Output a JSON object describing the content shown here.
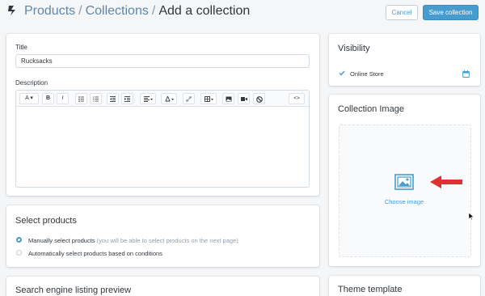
{
  "header": {
    "breadcrumb": {
      "products": "Products",
      "separator": "/",
      "collections": "Collections",
      "current": "Add a collection"
    },
    "cancel_label": "Cancel",
    "save_label": "Save collection"
  },
  "details": {
    "title_label": "Title",
    "title_value": "Rucksacks",
    "description_label": "Description",
    "toolbar": {
      "font_label": "A",
      "bold_label": "B",
      "italic_label": "I",
      "source_label": "<>"
    }
  },
  "select_products": {
    "heading": "Select products",
    "options": [
      {
        "label": "Manually select products",
        "hint": "(you will be able to select products on the next page)",
        "checked": true
      },
      {
        "label": "Automatically select products based on conditions",
        "hint": "",
        "checked": false
      }
    ]
  },
  "seo": {
    "heading": "Search engine listing preview"
  },
  "visibility": {
    "heading": "Visibility",
    "channel": "Online Store"
  },
  "collection_image": {
    "heading": "Collection Image",
    "choose_label": "Choose image"
  },
  "theme_template": {
    "heading": "Theme template"
  },
  "colors": {
    "accent": "#479ccf",
    "link": "#5f87aa",
    "annotation_arrow": "#e03131"
  }
}
